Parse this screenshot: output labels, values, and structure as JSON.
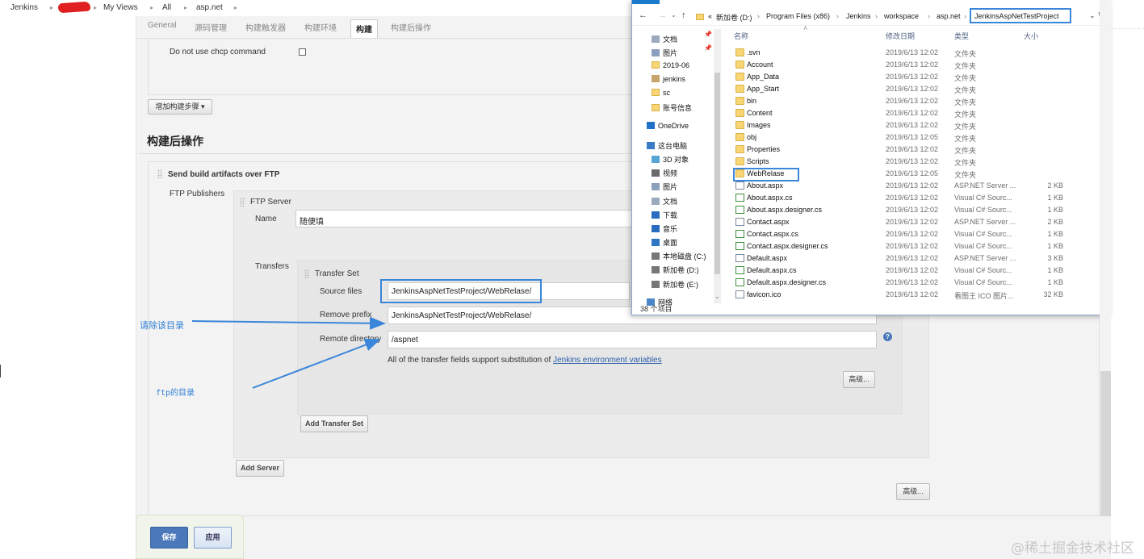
{
  "breadcrumb": {
    "items": [
      "Jenkins",
      "My Views",
      "All",
      "asp.net"
    ]
  },
  "tabs": [
    "General",
    "源码管理",
    "构建触发器",
    "构建环境",
    "构建",
    "构建后操作"
  ],
  "build": {
    "chcp_label": "Do not use chcp command",
    "add_step_label": "增加构建步骤"
  },
  "post_build": {
    "title": "构建后操作",
    "ftp_title": "Send build artifacts over FTP",
    "ftp_publishers_label": "FTP Publishers",
    "ftp_server_label": "FTP Server",
    "name_label": "Name",
    "name_value": "随便填",
    "transfers_label": "Transfers",
    "transfer_set_label": "Transfer Set",
    "source_files_label": "Source files",
    "source_files_value": "JenkinsAspNetTestProject/WebRelase/",
    "remove_prefix_label": "Remove prefix",
    "remove_prefix_value": "JenkinsAspNetTestProject/WebRelase/",
    "remote_dir_label": "Remote directory",
    "remote_dir_value": "/aspnet",
    "note_prefix": "All of the transfer fields support substitution of ",
    "note_link": "Jenkins environment variables",
    "advanced_label": "高级...",
    "add_transfer_set": "Add Transfer Set",
    "add_server": "Add Server",
    "advanced2_label": "高级..."
  },
  "buttons": {
    "save": "保存",
    "apply": "应用"
  },
  "annotations": {
    "clear_dir": "请除该目录",
    "ftp_dir": "ftp的目录"
  },
  "explorer": {
    "address": [
      "新加卷 (D:)",
      "Program Files (x86)",
      "Jenkins",
      "workspace",
      "asp.net",
      "JenkinsAspNetTestProject"
    ],
    "address_prefix": "«",
    "nav_items": [
      {
        "label": "文档",
        "icon": "document-icon"
      },
      {
        "label": "图片",
        "icon": "pictures-icon"
      },
      {
        "label": "2019-06",
        "icon": "folder-icon"
      },
      {
        "label": "jenkins",
        "icon": "jenkins-icon"
      },
      {
        "label": "sc",
        "icon": "folder-icon"
      },
      {
        "label": "账号信息",
        "icon": "folder-icon"
      },
      {
        "label": "OneDrive",
        "icon": "cloud-icon"
      },
      {
        "label": "这台电脑",
        "icon": "computer-icon"
      },
      {
        "label": "3D 对象",
        "icon": "cube-icon"
      },
      {
        "label": "视频",
        "icon": "video-icon"
      },
      {
        "label": "图片",
        "icon": "pictures-icon"
      },
      {
        "label": "文档",
        "icon": "document-icon"
      },
      {
        "label": "下载",
        "icon": "download-icon"
      },
      {
        "label": "音乐",
        "icon": "music-icon"
      },
      {
        "label": "桌面",
        "icon": "desktop-icon"
      },
      {
        "label": "本地磁盘 (C:)",
        "icon": "drive-icon"
      },
      {
        "label": "新加卷 (D:)",
        "icon": "drive-icon"
      },
      {
        "label": "新加卷 (E:)",
        "icon": "drive-icon"
      },
      {
        "label": "网络",
        "icon": "network-icon"
      }
    ],
    "columns": {
      "name": "名称",
      "date": "修改日期",
      "type": "类型",
      "size": "大小"
    },
    "files": [
      {
        "name": ".svn",
        "date": "2019/6/13 12:02",
        "type": "文件夹",
        "size": "",
        "kind": "folder"
      },
      {
        "name": "Account",
        "date": "2019/6/13 12:02",
        "type": "文件夹",
        "size": "",
        "kind": "folder"
      },
      {
        "name": "App_Data",
        "date": "2019/6/13 12:02",
        "type": "文件夹",
        "size": "",
        "kind": "folder"
      },
      {
        "name": "App_Start",
        "date": "2019/6/13 12:02",
        "type": "文件夹",
        "size": "",
        "kind": "folder"
      },
      {
        "name": "bin",
        "date": "2019/6/13 12:02",
        "type": "文件夹",
        "size": "",
        "kind": "folder"
      },
      {
        "name": "Content",
        "date": "2019/6/13 12:02",
        "type": "文件夹",
        "size": "",
        "kind": "folder"
      },
      {
        "name": "Images",
        "date": "2019/6/13 12:02",
        "type": "文件夹",
        "size": "",
        "kind": "folder"
      },
      {
        "name": "obj",
        "date": "2019/6/13 12:05",
        "type": "文件夹",
        "size": "",
        "kind": "folder"
      },
      {
        "name": "Properties",
        "date": "2019/6/13 12:02",
        "type": "文件夹",
        "size": "",
        "kind": "folder"
      },
      {
        "name": "Scripts",
        "date": "2019/6/13 12:02",
        "type": "文件夹",
        "size": "",
        "kind": "folder"
      },
      {
        "name": "WebRelase",
        "date": "2019/6/13 12:05",
        "type": "文件夹",
        "size": "",
        "kind": "folder"
      },
      {
        "name": "About.aspx",
        "date": "2019/6/13 12:02",
        "type": "ASP.NET Server ...",
        "size": "2 KB",
        "kind": "doc"
      },
      {
        "name": "About.aspx.cs",
        "date": "2019/6/13 12:02",
        "type": "Visual C# Sourc...",
        "size": "1 KB",
        "kind": "cs"
      },
      {
        "name": "About.aspx.designer.cs",
        "date": "2019/6/13 12:02",
        "type": "Visual C# Sourc...",
        "size": "1 KB",
        "kind": "cs"
      },
      {
        "name": "Contact.aspx",
        "date": "2019/6/13 12:02",
        "type": "ASP.NET Server ...",
        "size": "2 KB",
        "kind": "doc"
      },
      {
        "name": "Contact.aspx.cs",
        "date": "2019/6/13 12:02",
        "type": "Visual C# Sourc...",
        "size": "1 KB",
        "kind": "cs"
      },
      {
        "name": "Contact.aspx.designer.cs",
        "date": "2019/6/13 12:02",
        "type": "Visual C# Sourc...",
        "size": "1 KB",
        "kind": "cs"
      },
      {
        "name": "Default.aspx",
        "date": "2019/6/13 12:02",
        "type": "ASP.NET Server ...",
        "size": "3 KB",
        "kind": "doc"
      },
      {
        "name": "Default.aspx.cs",
        "date": "2019/6/13 12:02",
        "type": "Visual C# Sourc...",
        "size": "1 KB",
        "kind": "cs"
      },
      {
        "name": "Default.aspx.designer.cs",
        "date": "2019/6/13 12:02",
        "type": "Visual C# Sourc...",
        "size": "1 KB",
        "kind": "cs"
      },
      {
        "name": "favicon.ico",
        "date": "2019/6/13 12:02",
        "type": "看图王 ICO 图片...",
        "size": "32 KB",
        "kind": "doc"
      }
    ],
    "status": "38 个项目"
  },
  "watermark": "@稀土掘金技术社区",
  "colors": {
    "highlight": "#3a86d8",
    "annotation": "#2f7fd6",
    "save_button": "#4a78b8"
  }
}
